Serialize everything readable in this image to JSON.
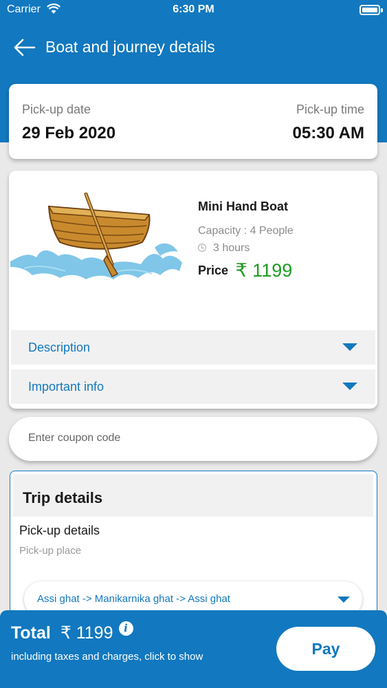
{
  "status_bar": {
    "carrier": "Carrier",
    "time": "6:30 PM"
  },
  "nav": {
    "title": "Boat and journey details"
  },
  "schedule": {
    "date_label": "Pick-up date",
    "date_value": "29 Feb 2020",
    "time_label": "Pick-up time",
    "time_value": "05:30 AM"
  },
  "boat": {
    "name": "Mini Hand Boat",
    "capacity": "Capacity :  4 People",
    "duration": "3 hours",
    "price_label": "Price",
    "price_value": "₹ 1199"
  },
  "accordions": [
    {
      "label": "Description"
    },
    {
      "label": "Important info"
    }
  ],
  "coupon": {
    "placeholder": "Enter coupon code"
  },
  "trip": {
    "title": "Trip details",
    "pickup_title": "Pick-up details",
    "pickup_place_label": "Pick-up place",
    "route": "Assi ghat -> Manikarnika ghat -> Assi ghat"
  },
  "footer": {
    "total_label": "Total",
    "total_value": "₹  1199",
    "note": "including taxes and charges, click to show",
    "pay_label": "Pay"
  },
  "colors": {
    "primary": "#1278bf",
    "price_green": "#1f9b22",
    "background": "#e9e9e9"
  }
}
